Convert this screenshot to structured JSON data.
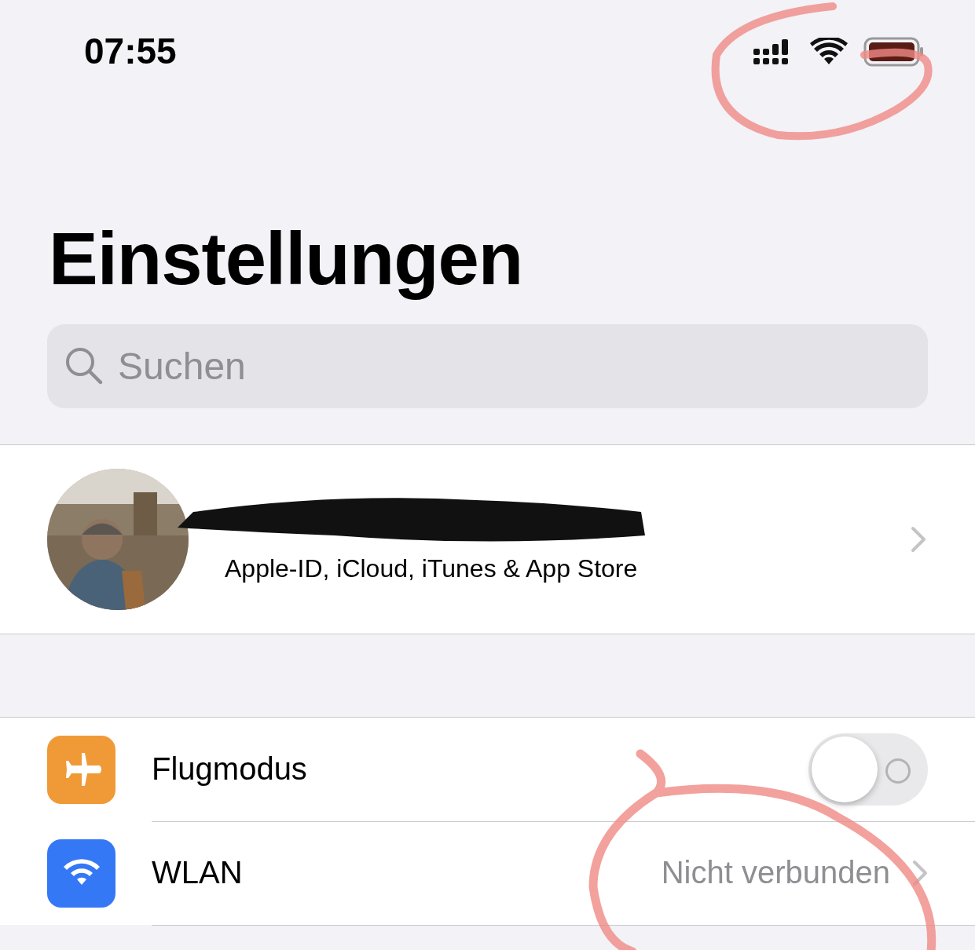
{
  "status_bar": {
    "time": "07:55"
  },
  "title": "Einstellungen",
  "search": {
    "placeholder": "Suchen"
  },
  "profile": {
    "subtitle": "Apple-ID, iCloud, iTunes & App Store"
  },
  "rows": [
    {
      "kind": "toggle",
      "label": "Flugmodus",
      "color": "#f09a37",
      "on": false
    },
    {
      "kind": "link",
      "label": "WLAN",
      "color": "#3478f6",
      "value": "Nicht verbunden"
    }
  ]
}
